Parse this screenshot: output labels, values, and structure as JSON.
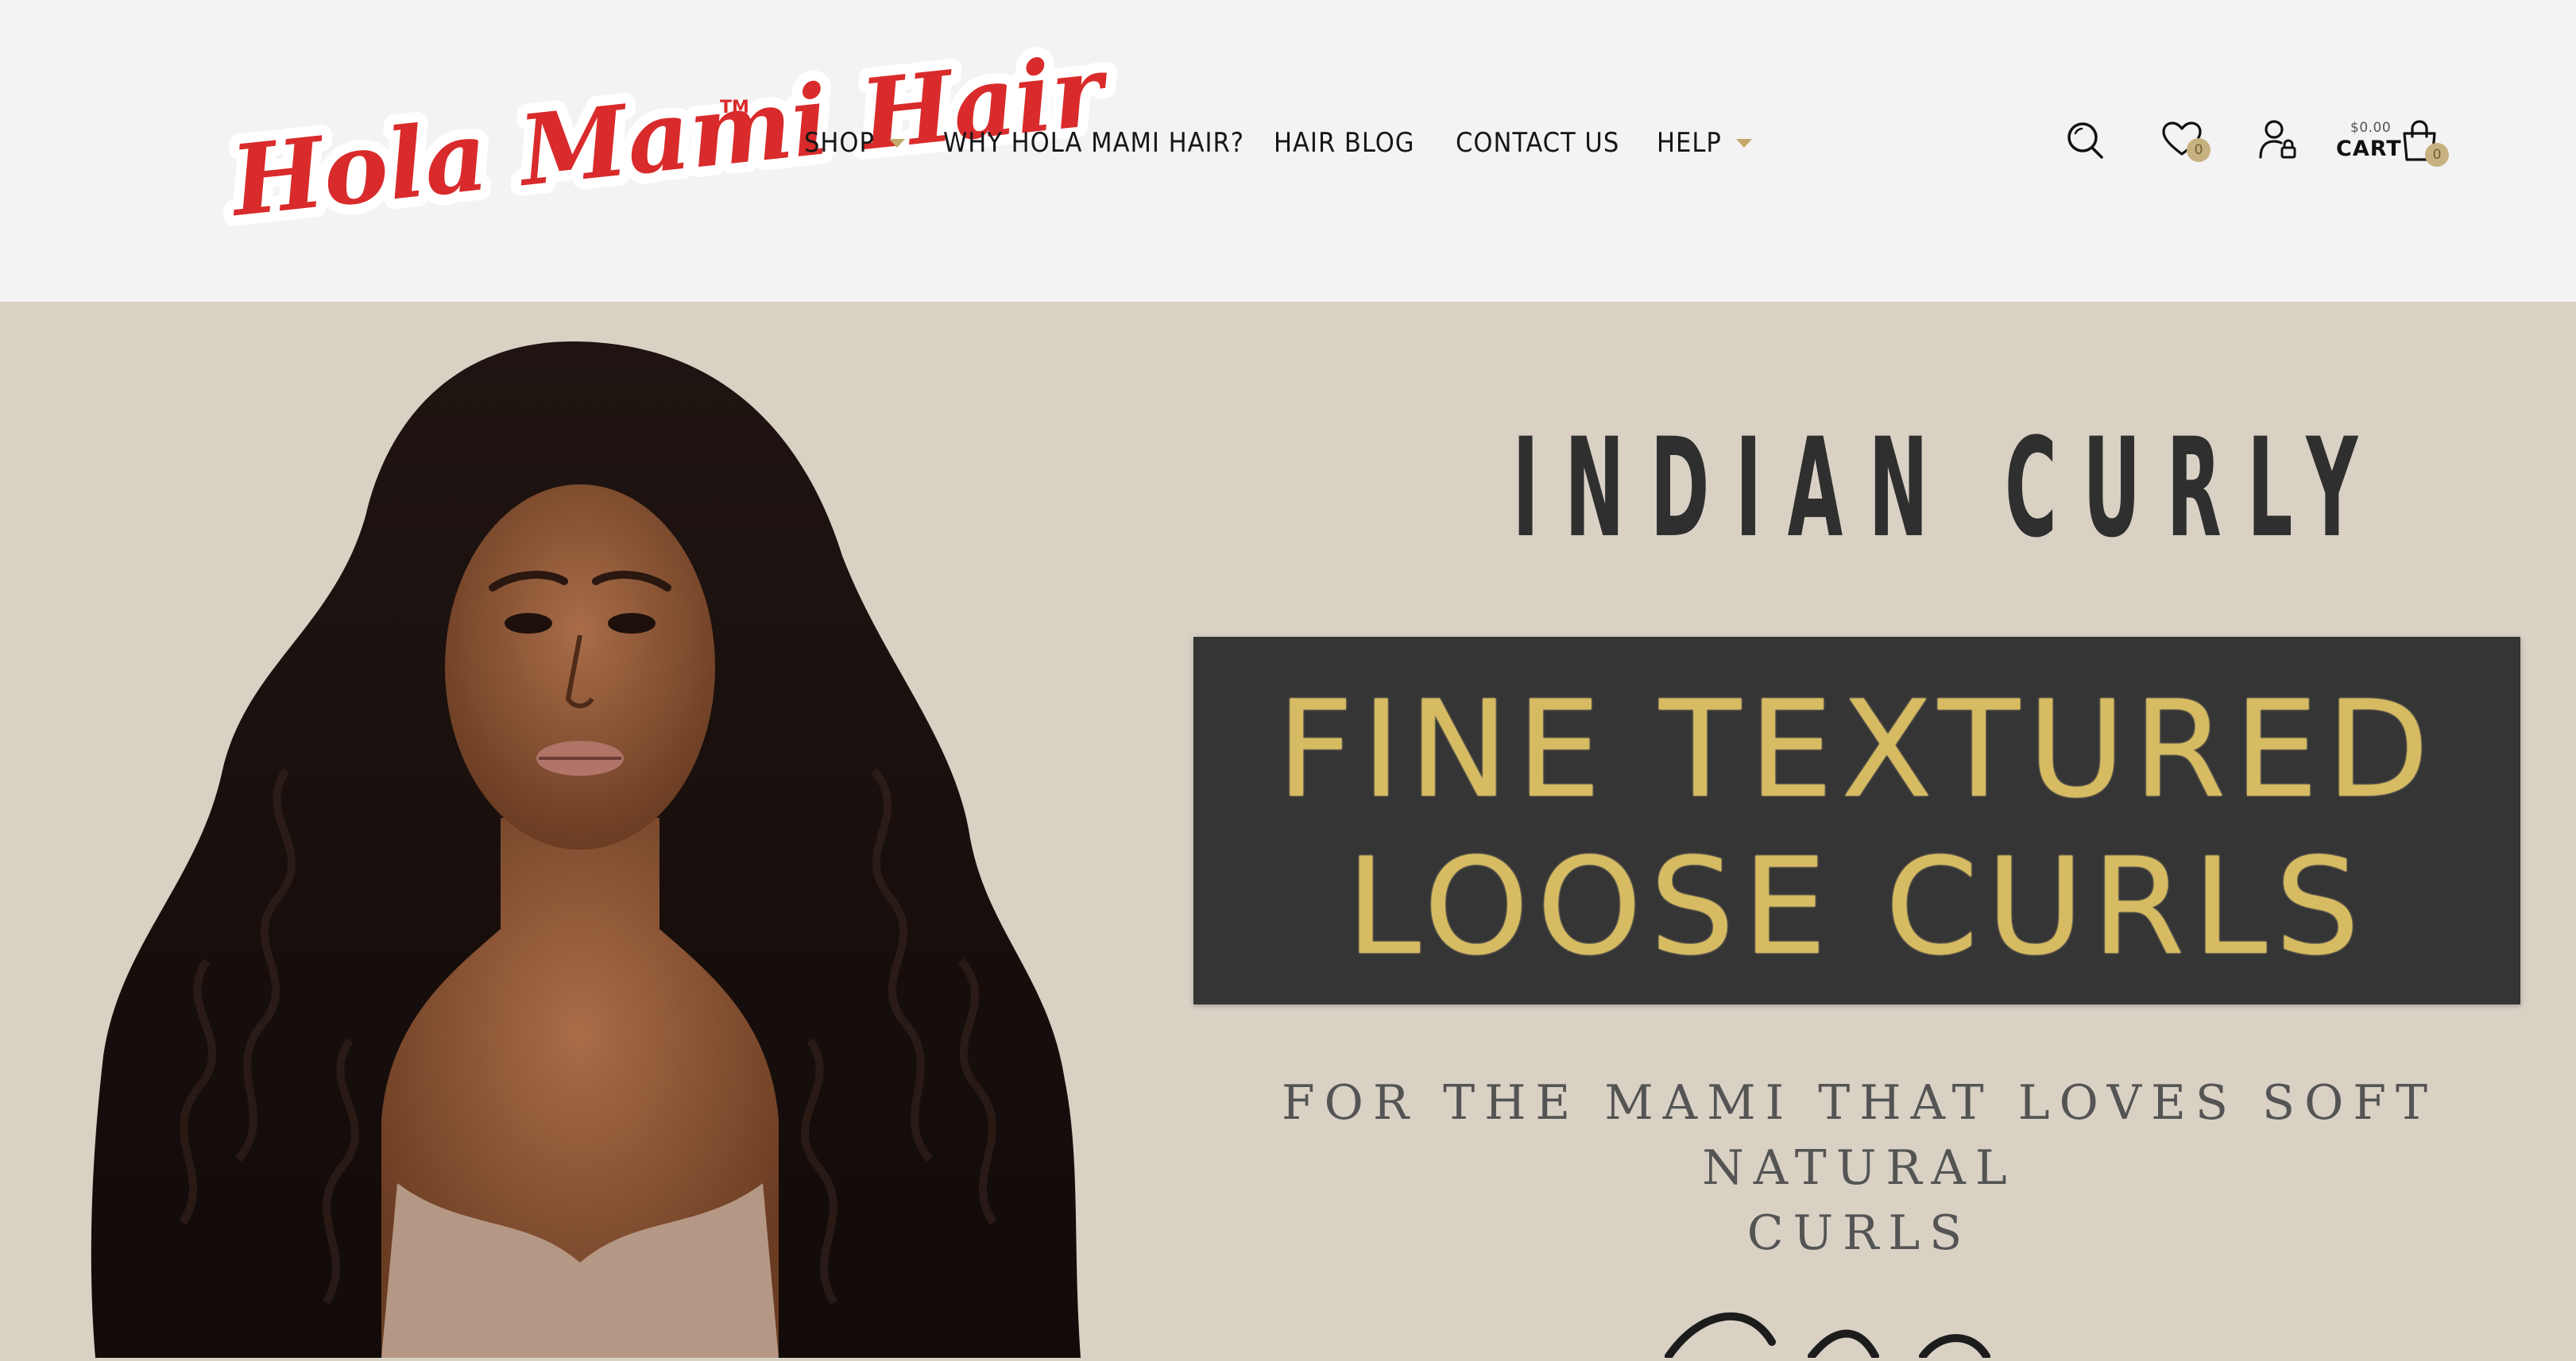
{
  "brand": {
    "logo_text": "Hola Mami Hair",
    "trademark": "TM",
    "colors": {
      "logo_red": "#d92b2b",
      "accent_gold": "#c3a86a",
      "hero_bg": "#d9d1c4",
      "header_bg": "#f3f3f3"
    }
  },
  "nav": {
    "items": [
      {
        "label": "SHOP",
        "has_dropdown": true
      },
      {
        "label": "WHY HOLA MAMI HAIR?",
        "has_dropdown": false
      },
      {
        "label": "HAIR BLOG",
        "has_dropdown": false
      },
      {
        "label": "CONTACT US",
        "has_dropdown": false
      },
      {
        "label": "HELP",
        "has_dropdown": true
      }
    ]
  },
  "header_icons": {
    "search": {
      "icon": "search-icon"
    },
    "wishlist": {
      "icon": "heart-icon",
      "count": "0"
    },
    "account": {
      "icon": "user-lock-icon"
    },
    "cart": {
      "icon": "shopping-bag-icon",
      "label": "CART",
      "price": "$0.00",
      "count": "0"
    }
  },
  "hero": {
    "headline": "INDIAN CURLY",
    "box_line1": "FINE TEXTURED",
    "box_line2": "LOOSE CURLS",
    "tagline_line1": "FOR THE MAMI THAT LOVES SOFT NATURAL",
    "tagline_line2": "CURLS"
  }
}
